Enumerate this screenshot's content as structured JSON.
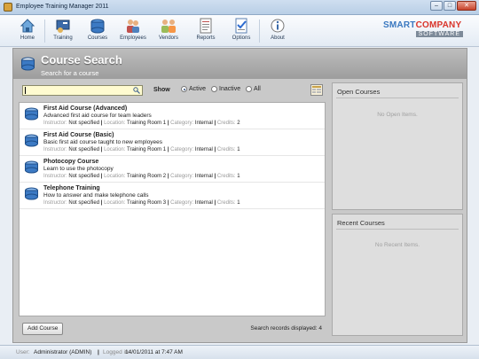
{
  "window": {
    "title": "Employee Training Manager 2011",
    "buttons": {
      "minimize": "–",
      "maximize": "□",
      "close": "✕"
    }
  },
  "toolbar": {
    "items": [
      {
        "label": "Home",
        "icon": "home-icon"
      },
      {
        "label": "Training",
        "icon": "training-icon"
      },
      {
        "label": "Courses",
        "icon": "courses-icon"
      },
      {
        "label": "Employees",
        "icon": "employees-icon"
      },
      {
        "label": "Vendors",
        "icon": "vendors-icon"
      },
      {
        "label": "Reports",
        "icon": "reports-icon"
      },
      {
        "label": "Options",
        "icon": "options-icon"
      },
      {
        "label": "About",
        "icon": "about-icon"
      }
    ],
    "logo_line1_a": "SMART",
    "logo_line1_b": "COMPANY",
    "logo_line2": "SOFTWARE"
  },
  "page": {
    "title": "Course Search",
    "subtitle": "Search for a course"
  },
  "search": {
    "value": "",
    "show_label": "Show",
    "filters": [
      {
        "label": "Active",
        "selected": true
      },
      {
        "label": "Inactive",
        "selected": false
      },
      {
        "label": "All",
        "selected": false
      }
    ]
  },
  "courses": [
    {
      "name": "First Aid Course (Advanced)",
      "description": "Advanced first aid course for team leaders",
      "instructor": "Not specified",
      "location": "Training Room 1",
      "category": "Internal",
      "credits": "2"
    },
    {
      "name": "First Aid Course (Basic)",
      "description": "Basic first aid course taught to new employees",
      "instructor": "Not specified",
      "location": "Training Room 1",
      "category": "Internal",
      "credits": "1"
    },
    {
      "name": "Photocopy Course",
      "description": "Learn to use the photocopy",
      "instructor": "Not specified",
      "location": "Training Room 2",
      "category": "Internal",
      "credits": "1"
    },
    {
      "name": "Telephone Training",
      "description": "How to answer and make telephone calls",
      "instructor": "Not specified",
      "location": "Training Room 3",
      "category": "Internal",
      "credits": "1"
    }
  ],
  "meta_labels": {
    "instructor": "Instructor:",
    "location": "Location:",
    "category": "Category:",
    "credits": "Credits:"
  },
  "bottom": {
    "add_button": "Add Course",
    "records_label": "Search records displayed:",
    "records_count": "4"
  },
  "open_courses": {
    "title": "Open Courses",
    "empty": "No Open Items."
  },
  "recent_courses": {
    "title": "Recent Courses",
    "empty": "No Recent Items."
  },
  "status": {
    "user_label": "User:",
    "user_value": "Administrator (ADMIN)",
    "logged_label": "Logged in:",
    "logged_value": "14/01/2011 at 7:47 AM"
  },
  "colors": {
    "accent": "#3a78c0",
    "header_gray": "#a8a8a8",
    "search_bg": "#fffbd0"
  }
}
